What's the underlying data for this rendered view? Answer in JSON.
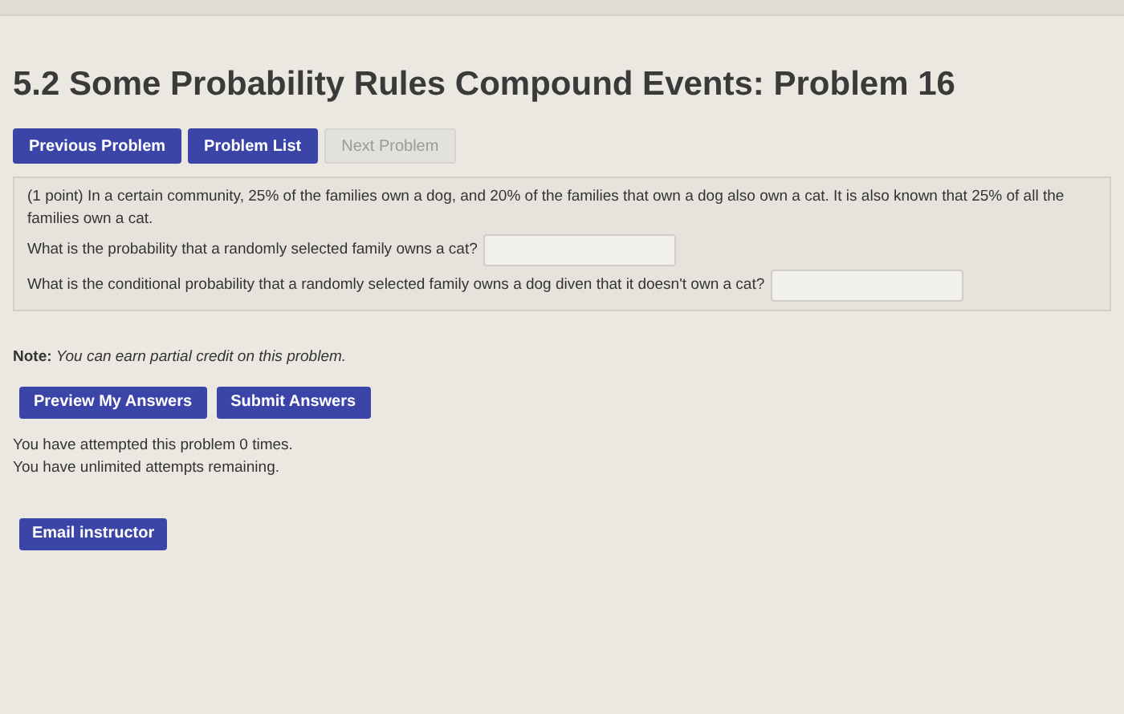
{
  "title": "5.2 Some Probability Rules Compound Events: Problem 16",
  "nav_buttons": [
    {
      "label": "Previous Problem",
      "disabled": false
    },
    {
      "label": "Problem List",
      "disabled": false
    },
    {
      "label": "Next Problem",
      "disabled": true
    }
  ],
  "problem": {
    "intro": "(1 point) In a certain community, 25% of the families own a dog, and 20% of the families that own a dog also own a cat. It is also known that 25% of all the families own a cat.",
    "questions": [
      {
        "text": "What is the probability that a randomly selected family owns a cat?"
      },
      {
        "text": "What is the conditional probability that a randomly selected family owns a dog diven that it doesn't own a cat?"
      }
    ]
  },
  "note": "**Note:** *You can earn partial credit on this problem.*",
  "answer_buttons": [
    "Preview My Answers",
    "Submit Answers"
  ],
  "attempts": [
    "You have attempted this problem 0 times.",
    "You have unlimited attempts remaining."
  ],
  "email_button": "Email instructor"
}
